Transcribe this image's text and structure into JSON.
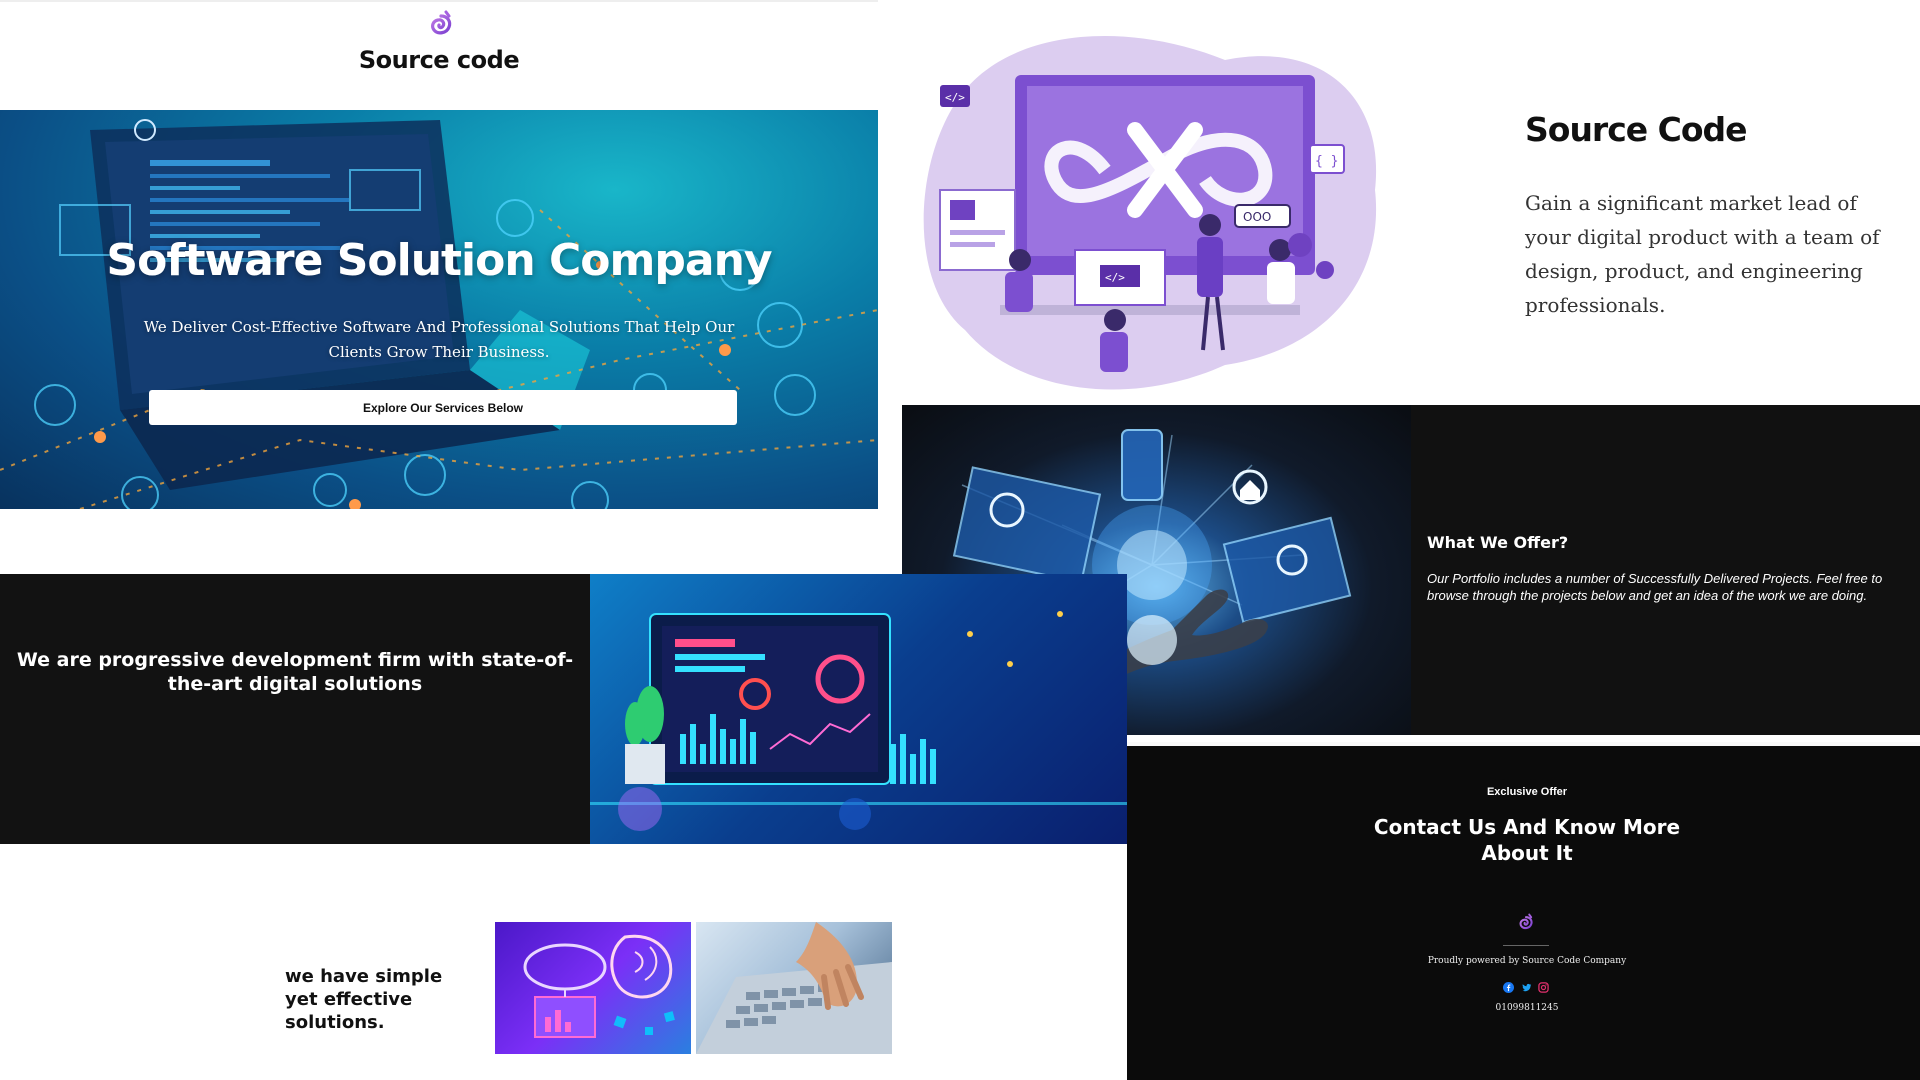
{
  "header": {
    "brand": "Source code",
    "logo_icon": "spiral-logo-icon"
  },
  "hero": {
    "title": "Software Solution Company",
    "subtitle": "We Deliver Cost-Effective Software And Professional Solutions That Help Our Clients Grow Their Business.",
    "button_label": "Explore Our Services Below"
  },
  "source_code": {
    "title": "Source Code",
    "text": "Gain a significant market lead of your digital product with a team of design, product, and engineering professionals."
  },
  "offer": {
    "title": "What We Offer?",
    "text": "Our Portfolio includes a number of Successfully Delivered Projects. Feel free to browse through the projects below and get an idea of the work we are doing."
  },
  "progressive": {
    "text": "We are progressive development firm with state-of-the-art digital solutions"
  },
  "exclusive": {
    "label": "Exclusive Offer",
    "title": "Contact Us And Know More About It",
    "powered": "Proudly powered by Source Code Company",
    "phone": "01099811245",
    "socials": [
      "facebook-icon",
      "twitter-icon",
      "instagram-icon"
    ]
  },
  "simple": {
    "text": "we have simple yet effective solutions."
  },
  "colors": {
    "brand_purple": "#8b4fd6",
    "dark_panel": "#121212",
    "hero_teal": "#0a7ea8"
  }
}
